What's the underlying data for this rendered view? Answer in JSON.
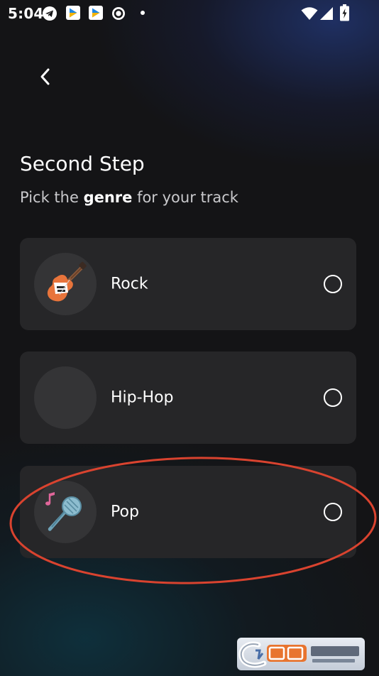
{
  "status_bar": {
    "time": "5:04",
    "notification_icons": [
      "telegram-icon",
      "play-store-icon",
      "play-store-icon",
      "circle-status-icon",
      "dot-icon"
    ],
    "system_icons": [
      "wifi-icon",
      "signal-icon",
      "battery-charging-icon"
    ]
  },
  "header": {
    "back_icon": "chevron-left-icon",
    "title": "Second Step",
    "subtitle_prefix": "Pick the ",
    "subtitle_emphasis": "genre",
    "subtitle_suffix": " for your track"
  },
  "genres": [
    {
      "label": "Rock",
      "icon": "electric-guitar-icon",
      "selected": false
    },
    {
      "label": "Hip-Hop",
      "icon": "",
      "selected": false
    },
    {
      "label": "Pop",
      "icon": "microphone-icon",
      "selected": false
    }
  ],
  "annotation": {
    "shape": "ellipse",
    "target": "Pop",
    "color": "#d9432f"
  },
  "colors": {
    "background": "#141416",
    "card": "#262628",
    "avatar": "#343436",
    "guitar": "#e8743b",
    "microphone": "#6fa3b8",
    "music_note": "#e0669a"
  }
}
